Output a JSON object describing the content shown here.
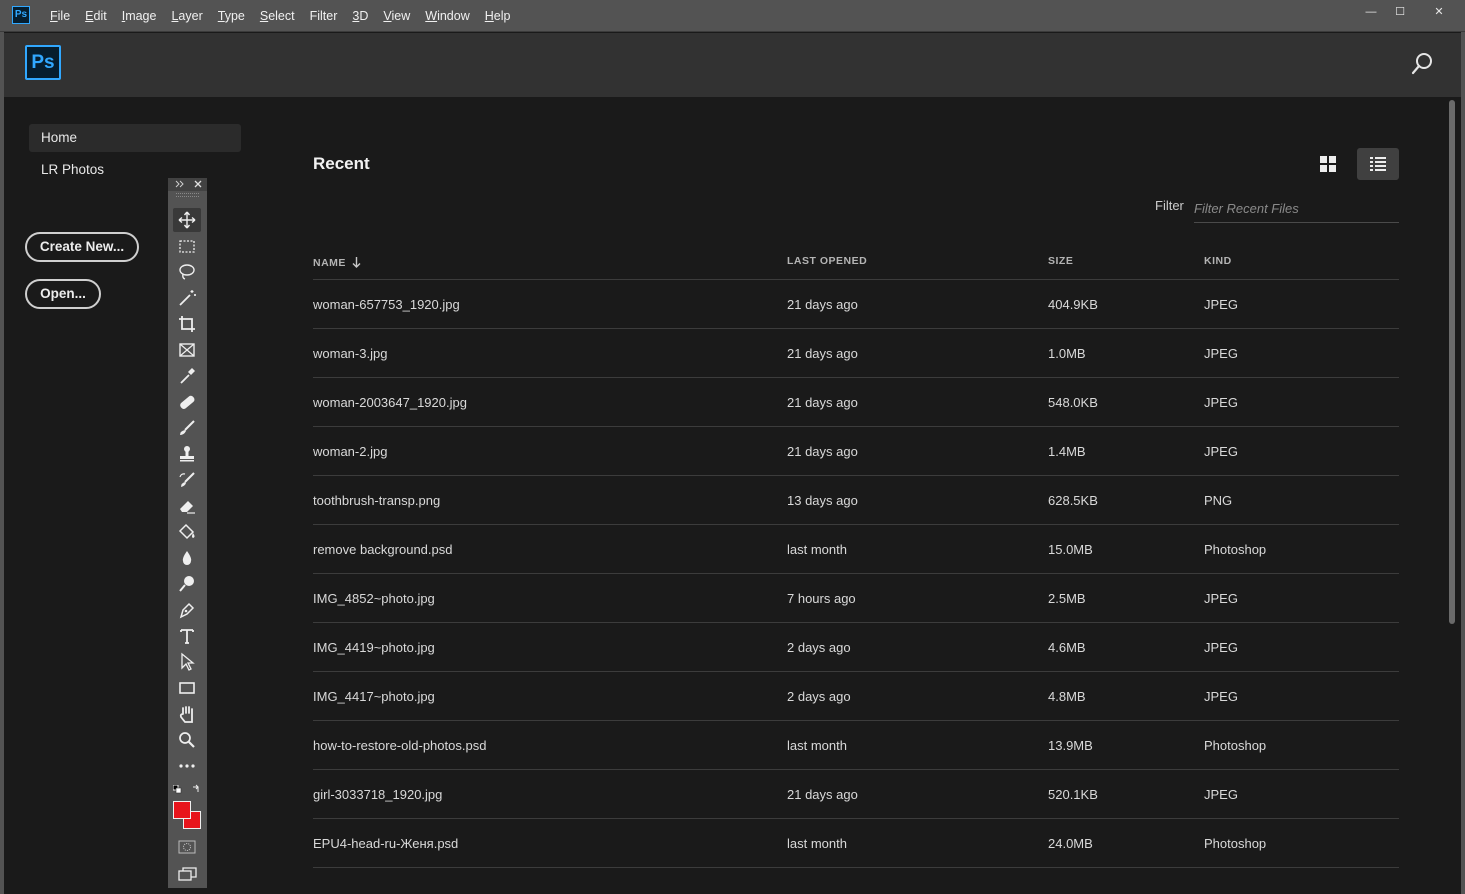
{
  "menubar": {
    "app_icon": "Ps",
    "menus": [
      {
        "label": "File",
        "u": "F",
        "rest": "ile"
      },
      {
        "label": "Edit",
        "u": "E",
        "rest": "dit"
      },
      {
        "label": "Image",
        "u": "I",
        "rest": "mage"
      },
      {
        "label": "Layer",
        "u": "L",
        "rest": "ayer"
      },
      {
        "label": "Type",
        "u": "T",
        "rest": "ype"
      },
      {
        "label": "Select",
        "u": "S",
        "rest": "elect"
      },
      {
        "label": "Filter",
        "u": "",
        "rest": "Filter"
      },
      {
        "label": "3D",
        "u": "3",
        "rest": "D"
      },
      {
        "label": "View",
        "u": "V",
        "rest": "iew"
      },
      {
        "label": "Window",
        "u": "W",
        "rest": "indow"
      },
      {
        "label": "Help",
        "u": "H",
        "rest": "elp"
      }
    ],
    "window_controls": {
      "minimize": "—",
      "maximize": "☐",
      "close": "✕"
    }
  },
  "header": {
    "logo": "Ps",
    "search_icon": "search-icon"
  },
  "sidebar": {
    "items": [
      {
        "label": "Home",
        "active": true
      },
      {
        "label": "LR Photos",
        "active": false
      }
    ],
    "create_new_label": "Create New...",
    "open_label": "Open..."
  },
  "toolbar": {
    "tools": [
      "move-tool",
      "marquee-tool",
      "lasso-tool",
      "magic-wand-tool",
      "crop-tool",
      "frame-tool",
      "eyedropper-tool",
      "healing-brush-tool",
      "brush-tool",
      "clone-stamp-tool",
      "history-brush-tool",
      "eraser-tool",
      "paint-bucket-tool",
      "blur-tool",
      "dodge-tool",
      "pen-tool",
      "type-tool",
      "path-selection-tool",
      "rectangle-tool",
      "hand-tool",
      "zoom-tool",
      "edit-toolbar"
    ],
    "foreground_color": "#e8141b",
    "background_color": "#e8141b"
  },
  "recent": {
    "title": "Recent",
    "filter_label": "Filter",
    "filter_placeholder": "Filter Recent Files",
    "filter_value": "",
    "columns": {
      "name": "NAME",
      "last_opened": "LAST OPENED",
      "size": "SIZE",
      "kind": "KIND"
    },
    "sort": {
      "column": "name",
      "direction": "descending"
    },
    "files": [
      {
        "name": "woman-657753_1920.jpg",
        "last_opened": "21 days ago",
        "size": "404.9KB",
        "kind": "JPEG"
      },
      {
        "name": "woman-3.jpg",
        "last_opened": "21 days ago",
        "size": "1.0MB",
        "kind": "JPEG"
      },
      {
        "name": "woman-2003647_1920.jpg",
        "last_opened": "21 days ago",
        "size": "548.0KB",
        "kind": "JPEG"
      },
      {
        "name": "woman-2.jpg",
        "last_opened": "21 days ago",
        "size": "1.4MB",
        "kind": "JPEG"
      },
      {
        "name": "toothbrush-transp.png",
        "last_opened": "13 days ago",
        "size": "628.5KB",
        "kind": "PNG"
      },
      {
        "name": "remove background.psd",
        "last_opened": "last month",
        "size": "15.0MB",
        "kind": "Photoshop"
      },
      {
        "name": "IMG_4852~photo.jpg",
        "last_opened": "7 hours ago",
        "size": "2.5MB",
        "kind": "JPEG"
      },
      {
        "name": "IMG_4419~photo.jpg",
        "last_opened": "2 days ago",
        "size": "4.6MB",
        "kind": "JPEG"
      },
      {
        "name": "IMG_4417~photo.jpg",
        "last_opened": "2 days ago",
        "size": "4.8MB",
        "kind": "JPEG"
      },
      {
        "name": "how-to-restore-old-photos.psd",
        "last_opened": "last month",
        "size": "13.9MB",
        "kind": "Photoshop"
      },
      {
        "name": "girl-3033718_1920.jpg",
        "last_opened": "21 days ago",
        "size": "520.1KB",
        "kind": "JPEG"
      },
      {
        "name": "EPU4-head-ru-Женя.psd",
        "last_opened": "last month",
        "size": "24.0MB",
        "kind": "Photoshop"
      }
    ]
  },
  "colors": {
    "accent": "#31a8ff",
    "bg": "#1a1a1a",
    "header": "#323232",
    "chrome": "#535353"
  }
}
